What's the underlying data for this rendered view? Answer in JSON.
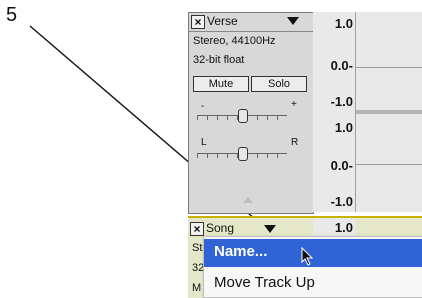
{
  "callout": {
    "number": "5"
  },
  "verse_track": {
    "name": "Verse",
    "info_line1": "Stereo, 44100Hz",
    "info_line2": "32-bit float",
    "mute_label": "Mute",
    "solo_label": "Solo",
    "gain_minus": "-",
    "gain_plus": "+",
    "pan_left": "L",
    "pan_right": "R",
    "ruler": [
      "1.0",
      "0.0-",
      "-1.0",
      "1.0",
      "0.0-",
      "-1.0"
    ]
  },
  "song_track": {
    "name": "Song",
    "ruler_top": "1.0",
    "stub_lines": [
      "Ste",
      "32",
      "M"
    ]
  },
  "context_menu": {
    "items": [
      {
        "label": "Name...",
        "selected": true
      },
      {
        "label": "Move Track Up",
        "selected": false
      }
    ]
  },
  "colors": {
    "selection": "#2f63d6",
    "song_track_bg": "#e4e8c8",
    "song_track_border": "#c8b400"
  },
  "icons": [
    "close-icon",
    "dropdown-arrow-icon",
    "collapse-arrow-icon",
    "pointer-cursor-icon"
  ]
}
